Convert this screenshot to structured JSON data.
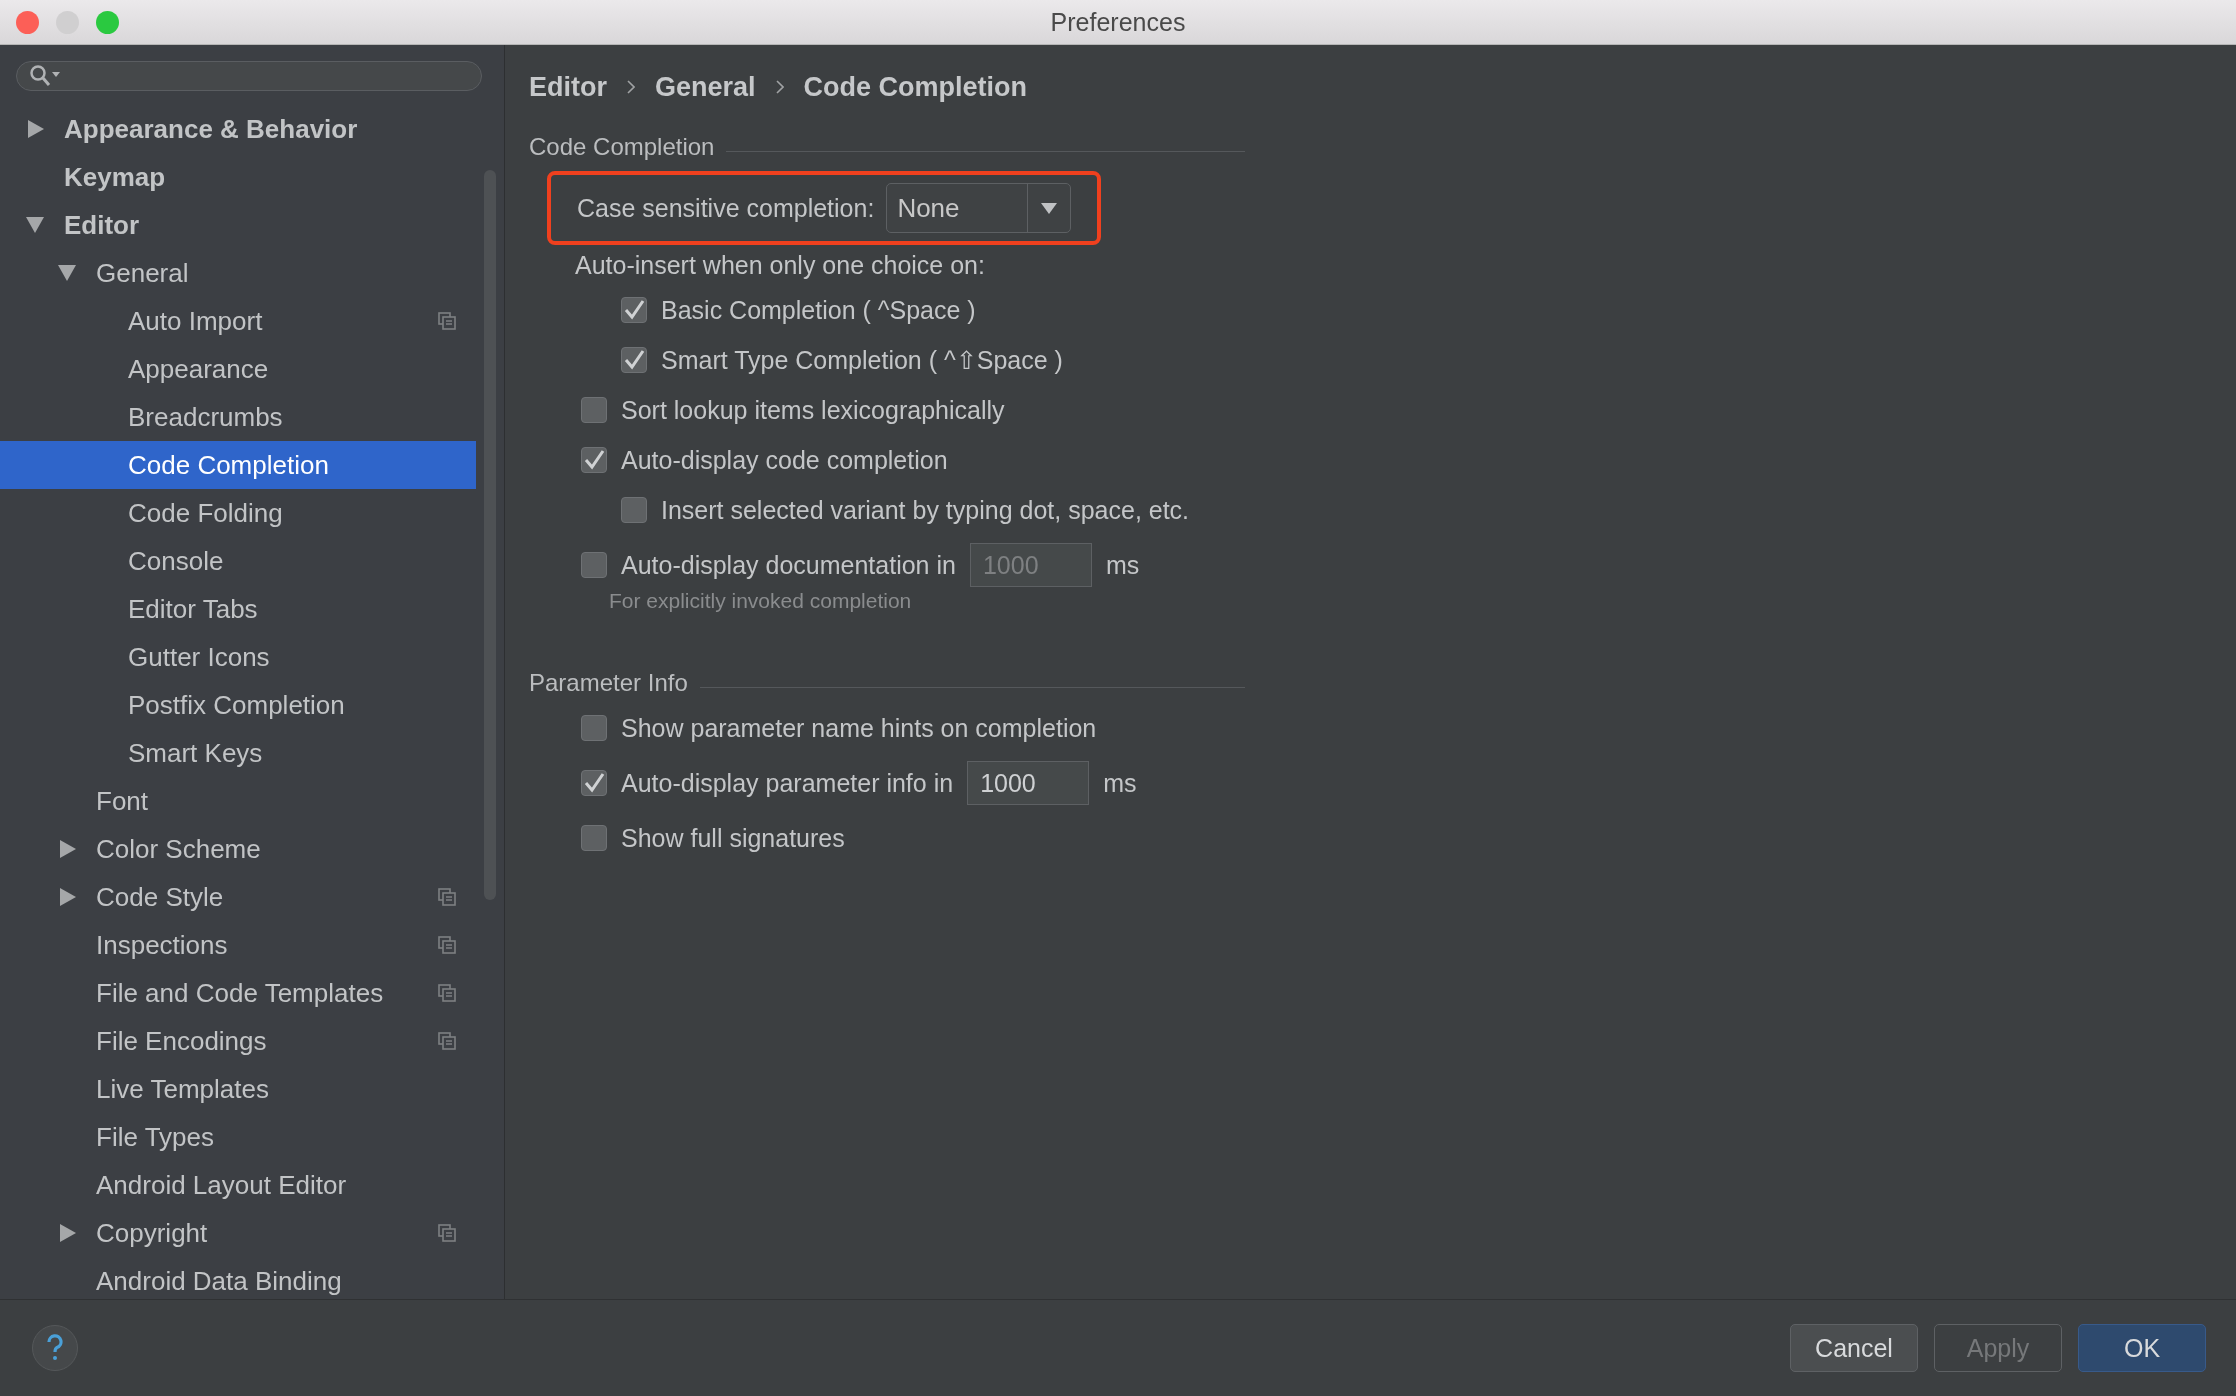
{
  "window": {
    "title": "Preferences"
  },
  "sidebar": {
    "tree": [
      {
        "label": "Appearance & Behavior",
        "bold": true,
        "expanded": false,
        "selected": false
      },
      {
        "label": "Keymap",
        "bold": true,
        "selected": false
      },
      {
        "label": "Editor",
        "bold": true,
        "expanded": true,
        "selected": false,
        "children": [
          {
            "label": "General",
            "expanded": true,
            "selected": false,
            "children": [
              {
                "label": "Auto Import",
                "scoped": true,
                "selected": false
              },
              {
                "label": "Appearance",
                "selected": false
              },
              {
                "label": "Breadcrumbs",
                "selected": false
              },
              {
                "label": "Code Completion",
                "selected": true
              },
              {
                "label": "Code Folding",
                "selected": false
              },
              {
                "label": "Console",
                "selected": false
              },
              {
                "label": "Editor Tabs",
                "selected": false
              },
              {
                "label": "Gutter Icons",
                "selected": false
              },
              {
                "label": "Postfix Completion",
                "selected": false
              },
              {
                "label": "Smart Keys",
                "selected": false
              }
            ]
          },
          {
            "label": "Font",
            "selected": false
          },
          {
            "label": "Color Scheme",
            "expanded": false,
            "selected": false
          },
          {
            "label": "Code Style",
            "expanded": false,
            "scoped": true,
            "selected": false
          },
          {
            "label": "Inspections",
            "scoped": true,
            "selected": false
          },
          {
            "label": "File and Code Templates",
            "scoped": true,
            "selected": false
          },
          {
            "label": "File Encodings",
            "scoped": true,
            "selected": false
          },
          {
            "label": "Live Templates",
            "selected": false
          },
          {
            "label": "File Types",
            "selected": false
          },
          {
            "label": "Android Layout Editor",
            "selected": false
          },
          {
            "label": "Copyright",
            "expanded": false,
            "scoped": true,
            "selected": false
          },
          {
            "label": "Android Data Binding",
            "selected": false
          }
        ]
      }
    ]
  },
  "breadcrumb": [
    "Editor",
    "General",
    "Code Completion"
  ],
  "sections": [
    {
      "title": "Code Completion",
      "options": [
        {
          "kind": "select",
          "label": "Case sensitive completion:",
          "value": "None",
          "highlighted": true
        },
        {
          "kind": "text",
          "label": "Auto-insert when only one choice on:",
          "children": [
            {
              "kind": "checkbox",
              "label": "Basic Completion ( ^Space )",
              "checked": true
            },
            {
              "kind": "checkbox",
              "label": "Smart Type Completion ( ^⇧Space )",
              "checked": true
            }
          ]
        },
        {
          "kind": "checkbox",
          "label": "Sort lookup items lexicographically",
          "checked": false
        },
        {
          "kind": "checkbox",
          "label": "Auto-display code completion",
          "checked": true,
          "children": [
            {
              "kind": "checkbox",
              "label": "Insert selected variant by typing dot, space, etc.",
              "checked": false
            }
          ]
        },
        {
          "kind": "number",
          "label": "Auto-display documentation in",
          "checked": false,
          "value": "1000",
          "unit": "ms",
          "hint": "For explicitly invoked completion"
        }
      ]
    },
    {
      "title": "Parameter Info",
      "options": [
        {
          "kind": "checkbox",
          "label": "Show parameter name hints on completion",
          "checked": false
        },
        {
          "kind": "number",
          "label": "Auto-display parameter info in",
          "checked": true,
          "value": "1000",
          "unit": "ms"
        },
        {
          "kind": "checkbox",
          "label": "Show full signatures",
          "checked": false
        }
      ]
    }
  ],
  "buttons": [
    {
      "label": "Cancel",
      "default": false,
      "disabled": false
    },
    {
      "label": "Apply",
      "default": false,
      "disabled": true
    },
    {
      "label": "OK",
      "default": true,
      "disabled": false
    }
  ]
}
